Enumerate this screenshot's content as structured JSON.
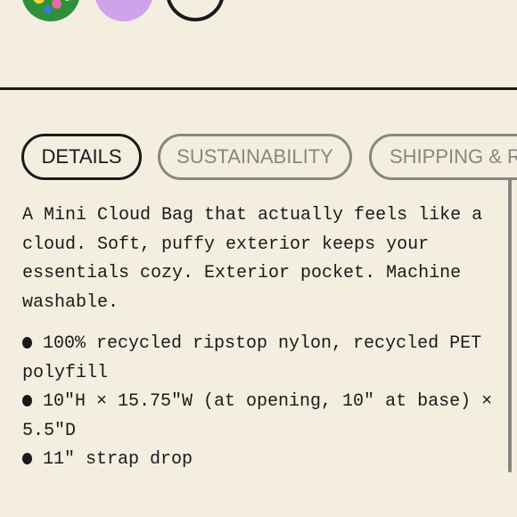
{
  "tabs": [
    {
      "label": "DETAILS",
      "active": true
    },
    {
      "label": "SUSTAINABILITY",
      "active": false
    },
    {
      "label": "SHIPPING & R",
      "active": false
    }
  ],
  "description": "A Mini Cloud Bag that actually feels like a cloud. Soft, puffy exterior keeps your essentials cozy. Exterior pocket. Machine washable.",
  "specs": [
    "100% recycled ripstop nylon, recycled PET polyfill",
    "10\"H × 15.75\"W (at opening, 10\" at base) × 5.5\"D",
    "11\" strap drop"
  ],
  "colors": {
    "background": "#f4eee1",
    "text": "#1a1a1a",
    "inactive": "#8a8580",
    "lavender": "#cfa3ea"
  }
}
